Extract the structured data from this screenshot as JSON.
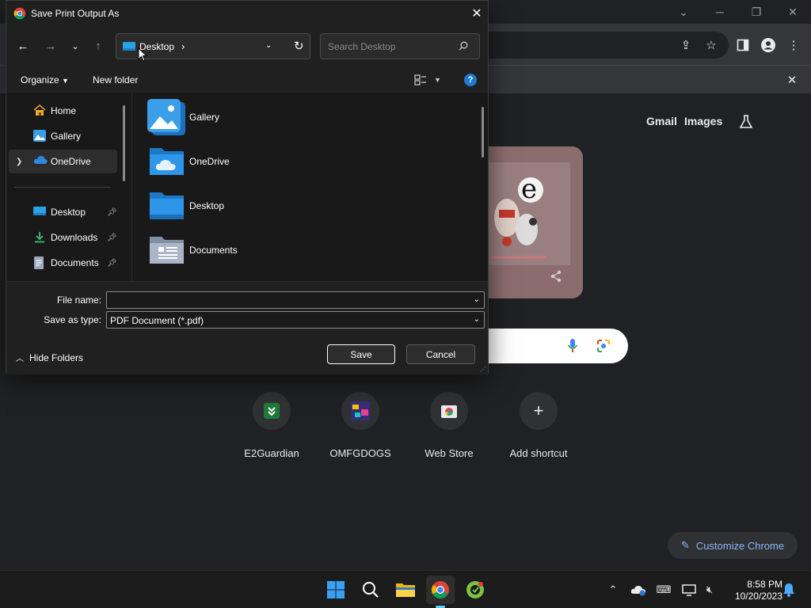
{
  "browser": {
    "top_links": [
      "Gmail",
      "Images"
    ],
    "shortcuts": [
      {
        "label": "E2Guardian",
        "icon": "e2guardian-icon"
      },
      {
        "label": "OMFGDOGS",
        "icon": "omfgdogs-icon"
      },
      {
        "label": "Web Store",
        "icon": "web-store-icon"
      },
      {
        "label": "Add shortcut",
        "icon": "plus-icon"
      }
    ],
    "customize_label": "Customize Chrome"
  },
  "dialog": {
    "title": "Save Print Output As",
    "address": {
      "location": "Desktop",
      "separator": "›"
    },
    "search_placeholder": "Search Desktop",
    "commands": {
      "organize": "Organize",
      "new_folder": "New folder"
    },
    "nav_items": [
      {
        "label": "Home",
        "icon": "home-icon"
      },
      {
        "label": "Gallery",
        "icon": "gallery-icon"
      },
      {
        "label": "OneDrive",
        "icon": "onedrive-icon",
        "selected": true,
        "expandable": true
      },
      {
        "label": "Desktop",
        "icon": "desktop-icon",
        "pinned": true
      },
      {
        "label": "Downloads",
        "icon": "downloads-icon",
        "pinned": true
      },
      {
        "label": "Documents",
        "icon": "documents-icon",
        "pinned": true
      }
    ],
    "files": [
      {
        "name": "Gallery",
        "icon": "gallery-icon"
      },
      {
        "name": "OneDrive",
        "icon": "onedrive-folder-icon"
      },
      {
        "name": "Desktop",
        "icon": "desktop-folder-icon"
      },
      {
        "name": "Documents",
        "icon": "documents-folder-icon"
      }
    ],
    "file_name_label": "File name:",
    "file_name_value": "",
    "save_type_label": "Save as type:",
    "save_type_value": "PDF Document (*.pdf)",
    "hide_folders": "Hide Folders",
    "save_button": "Save",
    "cancel_button": "Cancel"
  },
  "taskbar": {
    "time": "8:58 PM",
    "date": "10/20/2023",
    "apps": [
      "start-icon",
      "search-icon",
      "file-explorer-icon",
      "chrome-icon",
      "app-icon"
    ]
  },
  "colors": {
    "dialog_bg": "#202020",
    "content_bg": "#191919",
    "ntp_bg": "#202124",
    "accent_blue": "#8ab4f8",
    "help_blue": "#1e7ad4"
  }
}
